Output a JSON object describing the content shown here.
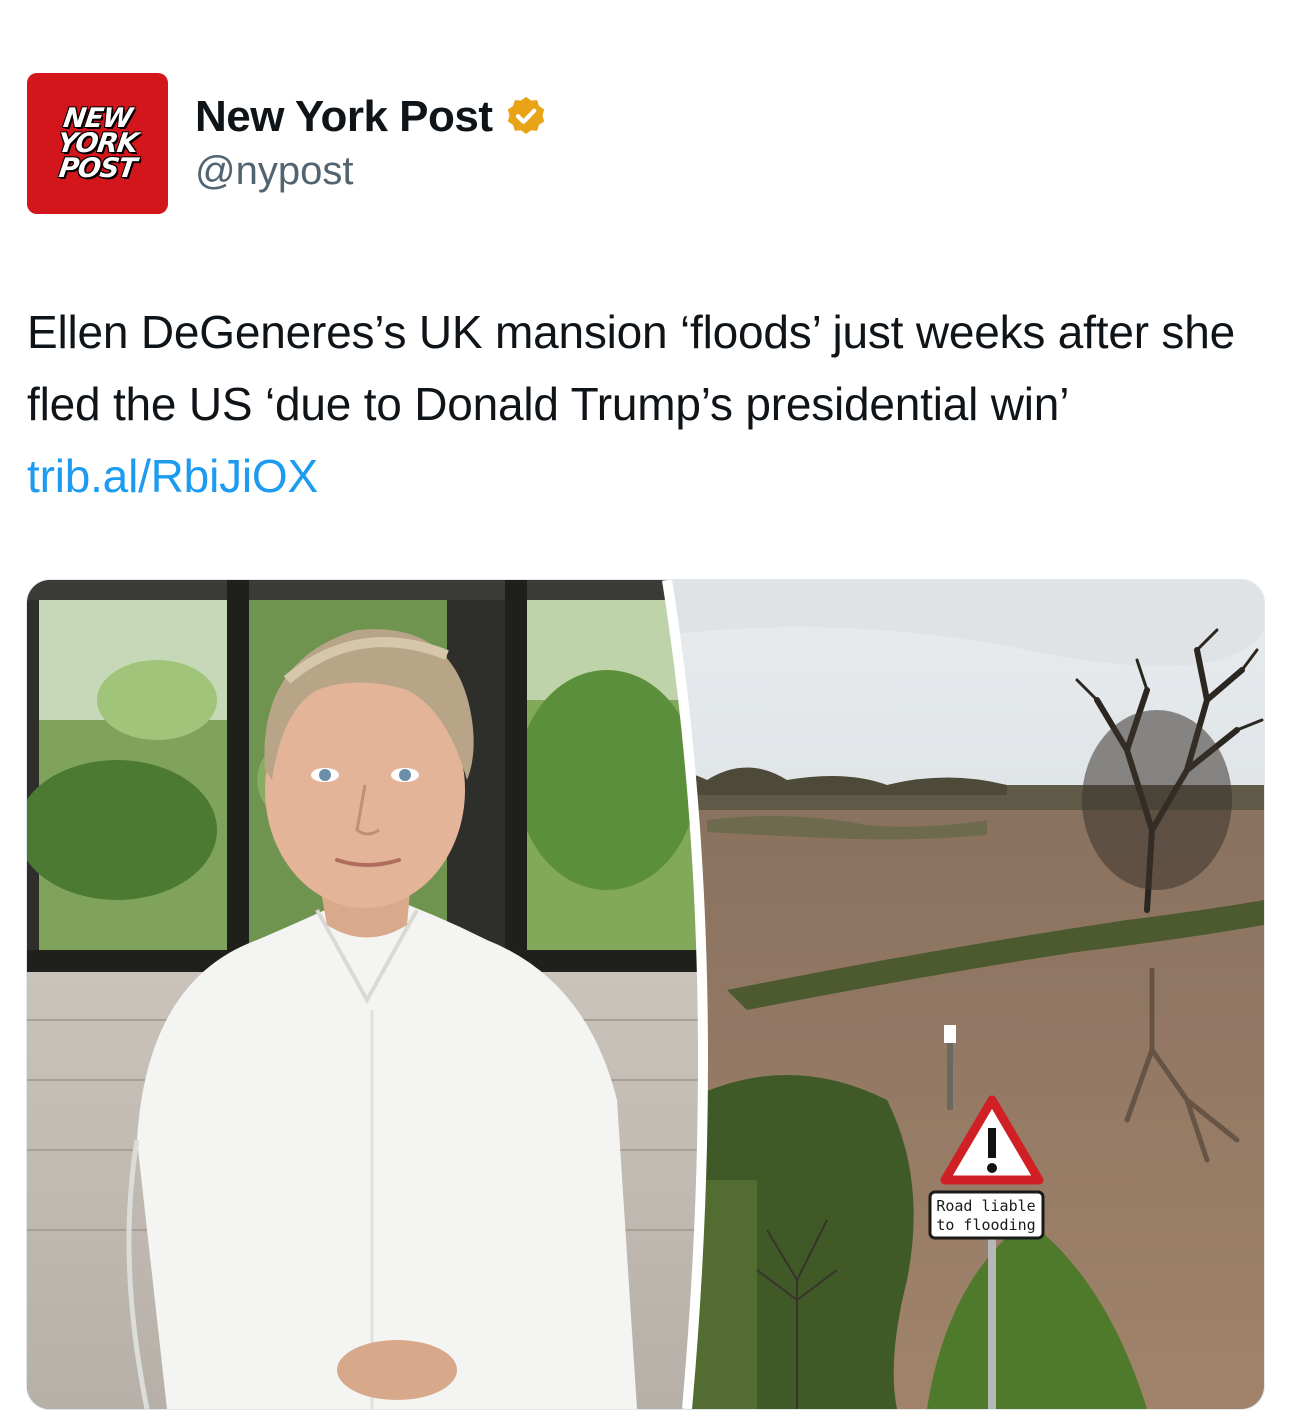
{
  "account": {
    "logo_lines": [
      "NEW",
      "YORK",
      "POST"
    ],
    "display_name": "New York Post",
    "handle": "@nypost",
    "verified_icon": "verified-badge-icon",
    "verified_color": "#e8a317"
  },
  "tweet": {
    "text": "Ellen DeGeneres’s UK mansion ‘floods’ just weeks after she fled the US ‘due to Donald Trump’s presidential win’ ",
    "link_text": "trib.al/RbiJiOX",
    "link_color": "#1d9bf0"
  },
  "media": {
    "sign_lines": [
      "Road liable",
      "to flooding"
    ]
  }
}
